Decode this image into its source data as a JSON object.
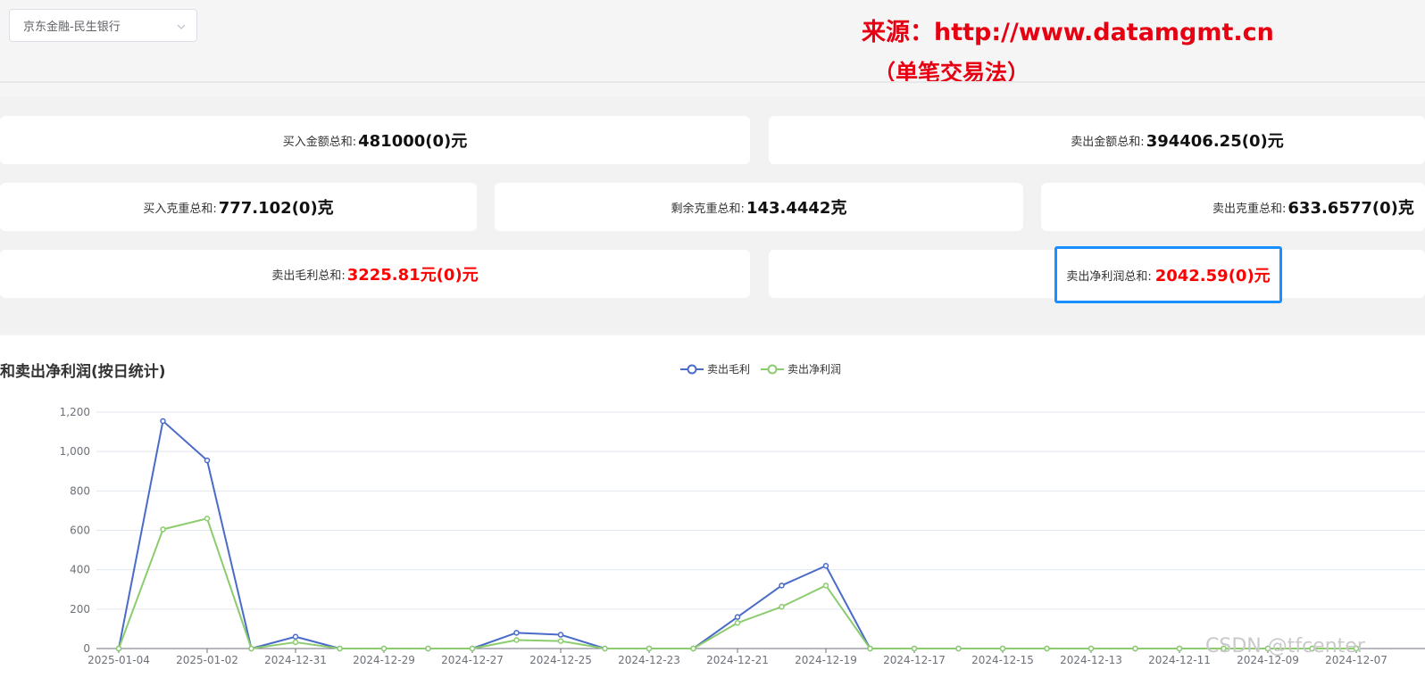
{
  "selector": {
    "value": "京东金融-民生银行"
  },
  "watermark": {
    "source": "来源：http://www.datamgmt.cn",
    "method": "（单笔交易法）"
  },
  "stats": {
    "buy_amount": {
      "label": "买入金额总和:",
      "value": "481000(0)元"
    },
    "sell_amount": {
      "label": "卖出金额总和:",
      "value": "394406.25(0)元"
    },
    "buy_weight": {
      "label": "买入克重总和:",
      "value": "777.102(0)克"
    },
    "remain_weight": {
      "label": "剩余克重总和:",
      "value": "143.4442克"
    },
    "sell_weight": {
      "label": "卖出克重总和:",
      "value": "633.6577(0)克"
    },
    "gross_profit": {
      "label": "卖出毛利总和:",
      "value": "3225.81元(0)元"
    },
    "net_profit": {
      "label": "卖出净利润总和:",
      "value": "2042.59(0)元"
    }
  },
  "chart_title": "和卖出净利润(按日统计)",
  "csdn_watermark": "CSDN @tfcenter",
  "chart_data": {
    "type": "line",
    "title": "和卖出净利润(按日统计)",
    "x": [
      "2025-01-04",
      "2025-01-03",
      "2025-01-02",
      "2025-01-01",
      "2024-12-31",
      "2024-12-30",
      "2024-12-29",
      "2024-12-28",
      "2024-12-27",
      "2024-12-26",
      "2024-12-25",
      "2024-12-24",
      "2024-12-23",
      "2024-12-22",
      "2024-12-21",
      "2024-12-20",
      "2024-12-19",
      "2024-12-18",
      "2024-12-17",
      "2024-12-16",
      "2024-12-15",
      "2024-12-14",
      "2024-12-13",
      "2024-12-12",
      "2024-12-11",
      "2024-12-10",
      "2024-12-09",
      "2024-12-08",
      "2024-12-07"
    ],
    "xtick_labels": [
      "2025-01-04",
      "2025-01-02",
      "2024-12-31",
      "2024-12-29",
      "2024-12-27",
      "2024-12-25",
      "2024-12-23",
      "2024-12-21",
      "2024-12-19",
      "2024-12-17",
      "2024-12-15",
      "2024-12-13",
      "2024-12-11",
      "2024-12-09",
      "2024-12-07"
    ],
    "ylim": [
      0,
      1200
    ],
    "yticks": [
      "0",
      "200",
      "400",
      "600",
      "800",
      "1,000",
      "1,200"
    ],
    "grid": true,
    "legend": "top-center",
    "series": [
      {
        "name": "卖出毛利",
        "color": "#4a6bc8",
        "values": [
          0,
          1155,
          955,
          0,
          60,
          0,
          0,
          0,
          0,
          80,
          70,
          0,
          0,
          0,
          160,
          320,
          420,
          0,
          0,
          0,
          0,
          0,
          0,
          0,
          0,
          0,
          0,
          0,
          0
        ]
      },
      {
        "name": "卖出净利润",
        "color": "#8ccc6e",
        "values": [
          0,
          605,
          660,
          0,
          32,
          0,
          0,
          0,
          0,
          43,
          38,
          0,
          0,
          0,
          130,
          212,
          320,
          0,
          0,
          0,
          0,
          0,
          0,
          0,
          0,
          0,
          0,
          0,
          0
        ]
      }
    ]
  }
}
